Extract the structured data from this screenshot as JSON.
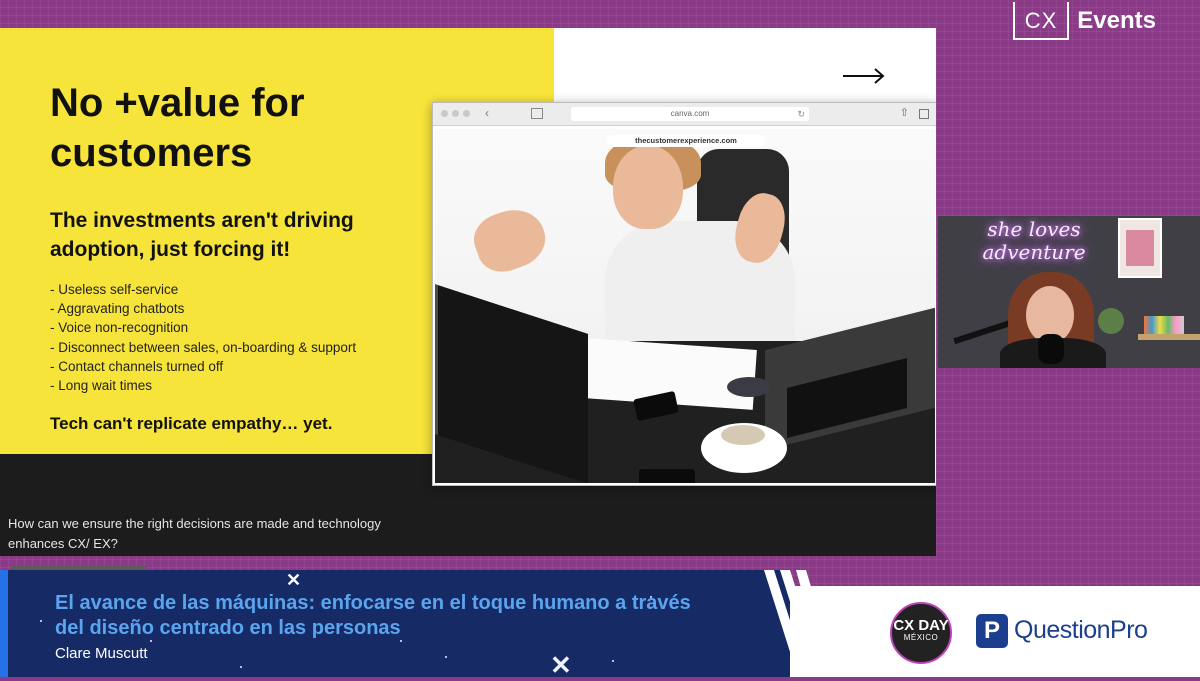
{
  "brand": {
    "cx_box": "CX",
    "word": "Events"
  },
  "slide": {
    "title": "No +value for customers",
    "subtitle": "The investments aren't driving adoption, just forcing it!",
    "bullets": [
      "Useless self-service",
      "Aggravating chatbots",
      "Voice non-recognition",
      "Disconnect between sales, on-boarding & support",
      "Contact channels turned off",
      "Long wait times"
    ],
    "tagline": "Tech can't replicate empathy… yet.",
    "question": "How can we ensure the right decisions are made and technology enhances CX/ EX?",
    "browser": {
      "url": "canva.com",
      "site_label": "thecustomerexperience.com"
    }
  },
  "webcam": {
    "neon_text": "she loves adventure"
  },
  "lower_third": {
    "title": "El avance de las máquinas: enfocarse en el toque humano a través del diseño centrado en las personas",
    "speaker": "Clare Muscutt"
  },
  "sponsors": {
    "cxday_line1": "CX DAY",
    "cxday_line2": "MÉXICO",
    "questionpro_icon": "P",
    "questionpro_name": "QuestionPro"
  },
  "colors": {
    "background": "#8a3a86",
    "slide_yellow": "#f7e43a",
    "lower_third": "#162a66",
    "title_blue": "#5aa5ee",
    "questionpro_blue": "#1b3f8e"
  }
}
